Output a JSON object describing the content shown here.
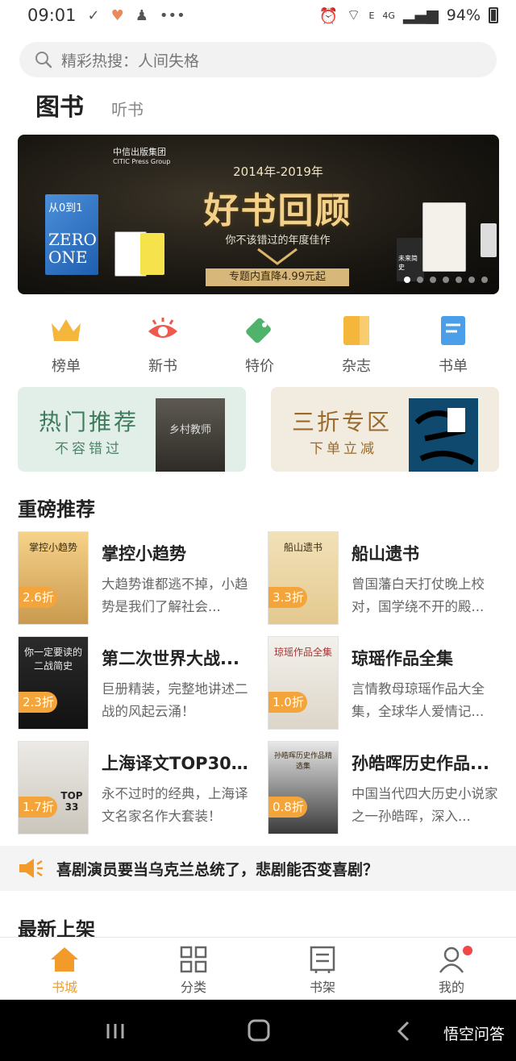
{
  "status": {
    "time": "09:01",
    "battery": "94%",
    "network": "4G",
    "signal_letter": "E"
  },
  "search": {
    "placeholder": "精彩热搜：人间失格"
  },
  "tabs": {
    "books": "图书",
    "audio": "听书"
  },
  "banner": {
    "publisher_cn": "中信出版集团",
    "publisher_en": "CITIC Press Group",
    "year_range": "2014年-2019年",
    "headline": "好书回顾",
    "subtitle": "你不该错过的年度佳作",
    "promo": "专题内直降4.99元起",
    "book_title_zero": "ZERO ONE",
    "book_title_cn": "从0到1",
    "book_small": "未来简史",
    "page_dots": 7,
    "active_dot": 0
  },
  "categories": [
    {
      "label": "榜单",
      "icon": "crown-icon",
      "color": "#f5b63c"
    },
    {
      "label": "新书",
      "icon": "eye-icon",
      "color": "#ef5a4e"
    },
    {
      "label": "特价",
      "icon": "tag-icon",
      "color": "#4fb36b"
    },
    {
      "label": "杂志",
      "icon": "magazine-icon",
      "color": "#f5b63c"
    },
    {
      "label": "书单",
      "icon": "booklist-icon",
      "color": "#4a9fe8"
    }
  ],
  "promo_cards": {
    "hot": {
      "title": "热门推荐",
      "sub": "不容错过",
      "cover_text": "乡村教师"
    },
    "discount": {
      "title": "三折专区",
      "sub": "下单立减"
    }
  },
  "sections": {
    "recommended": "重磅推荐",
    "new_arrivals": "最新上架"
  },
  "recommended": [
    {
      "title": "掌控小趋势",
      "desc": "大趋势谁都逃不掉，小趋势是我们了解社会...",
      "discount": "2.6折",
      "cover_text": "掌控小趋势"
    },
    {
      "title": "船山遗书",
      "desc": "曾国藩白天打仗晚上校对，国学绕不开的殿...",
      "discount": "3.3折",
      "cover_text": "船山遗书"
    },
    {
      "title": "第二次世界大战...",
      "desc": "巨册精装，完整地讲述二战的风起云涌！",
      "discount": "2.3折",
      "cover_text": "你一定要读的二战简史"
    },
    {
      "title": "琼瑶作品全集",
      "desc": "言情教母琼瑶作品大全集，全球华人爱情记...",
      "discount": "1.0折",
      "cover_text": "琼瑶作品全集"
    },
    {
      "title": "上海译文TOP30...",
      "desc": "永不过时的经典，上海译文名家名作大套装！",
      "discount": "1.7折",
      "cover_text": "TOP 33"
    },
    {
      "title": "孙皓晖历史作品...",
      "desc": "中国当代四大历史小说家之一孙皓晖，深入...",
      "discount": "0.8折",
      "cover_text": "孙皓晖历史作品精选集"
    }
  ],
  "news": {
    "text": "喜剧演员要当乌克兰总统了，悲剧能否变喜剧？"
  },
  "bottom_nav": [
    {
      "label": "书城",
      "icon": "home-icon",
      "active": true
    },
    {
      "label": "分类",
      "icon": "grid-icon",
      "active": false
    },
    {
      "label": "书架",
      "icon": "bookshelf-icon",
      "active": false
    },
    {
      "label": "我的",
      "icon": "profile-icon",
      "active": false
    }
  ],
  "watermark": "悟空问答",
  "colors": {
    "accent": "#f39b2a",
    "badge": "#f3a43b",
    "notification": "#f04848"
  }
}
